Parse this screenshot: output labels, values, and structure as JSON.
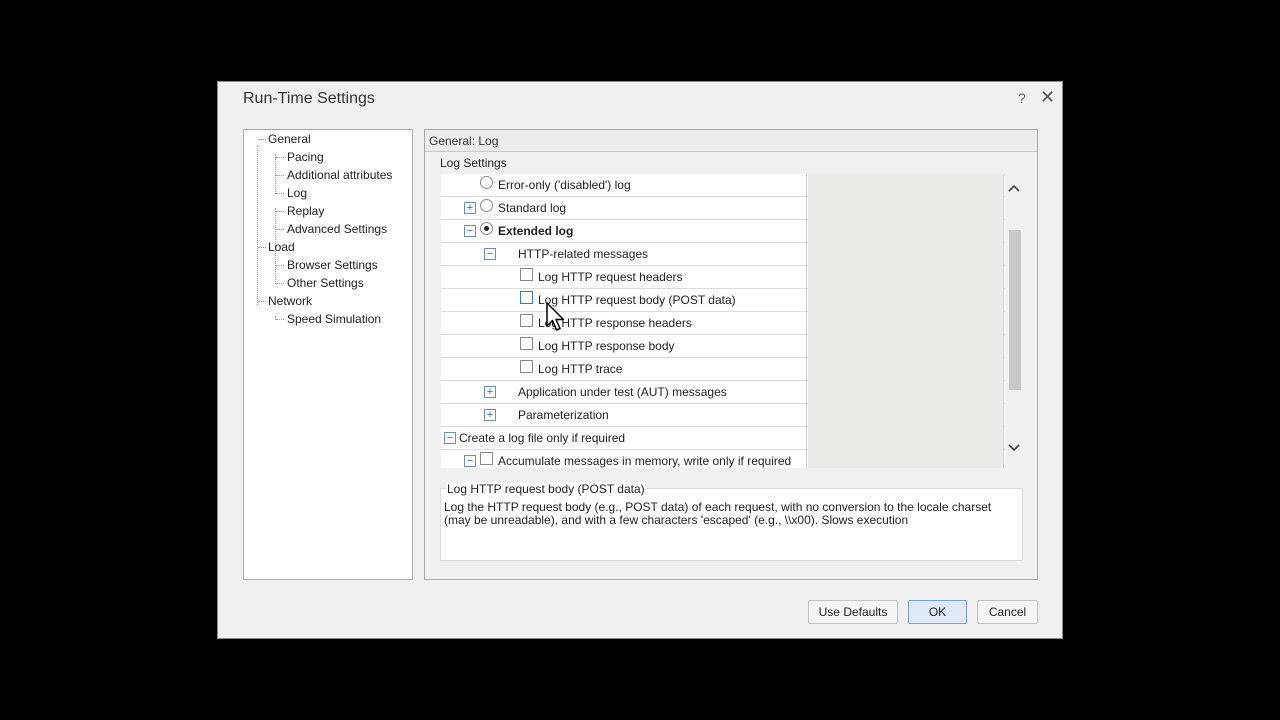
{
  "dialog": {
    "title": "Run-Time Settings",
    "help_label": "?",
    "close_label": "✕"
  },
  "tree": {
    "items": [
      {
        "label": "General"
      },
      {
        "label": "Pacing"
      },
      {
        "label": "Additional attributes"
      },
      {
        "label": "Log"
      },
      {
        "label": "Replay"
      },
      {
        "label": "Advanced Settings"
      },
      {
        "label": "Load"
      },
      {
        "label": "Browser Settings"
      },
      {
        "label": "Other Settings"
      },
      {
        "label": "Network"
      },
      {
        "label": "Speed Simulation"
      }
    ]
  },
  "panel": {
    "header": "General: Log",
    "section_label": "Log Settings"
  },
  "grid": {
    "rows": [
      {
        "label": "Error-only ('disabled') log"
      },
      {
        "label": "Standard log",
        "expander": "+"
      },
      {
        "label": "Extended log",
        "expander": "−"
      },
      {
        "label": "HTTP-related messages",
        "expander": "−"
      },
      {
        "label": "Log HTTP request headers"
      },
      {
        "label": "Log HTTP request body (POST data)"
      },
      {
        "label": "Log HTTP response headers"
      },
      {
        "label": "Log HTTP response body"
      },
      {
        "label": "Log HTTP trace"
      },
      {
        "label": "Application under test (AUT) messages",
        "expander": "+"
      },
      {
        "label": "Parameterization",
        "expander": "+"
      },
      {
        "label": "Create a log file only if required",
        "expander": "−"
      },
      {
        "label": "Accumulate messages in memory, write only if required",
        "expander": "−"
      }
    ]
  },
  "scrollbar": {
    "up_icon": "^",
    "down_icon": "v"
  },
  "description": {
    "title": "Log HTTP request body (POST data)",
    "text": "Log the HTTP request body (e.g., POST data) of each request, with no conversion to the locale charset (may be unreadable), and with a few characters 'escaped' (e.g., \\\\x00). Slows execution"
  },
  "buttons": {
    "use_defaults": "Use Defaults",
    "ok": "OK",
    "cancel": "Cancel"
  }
}
